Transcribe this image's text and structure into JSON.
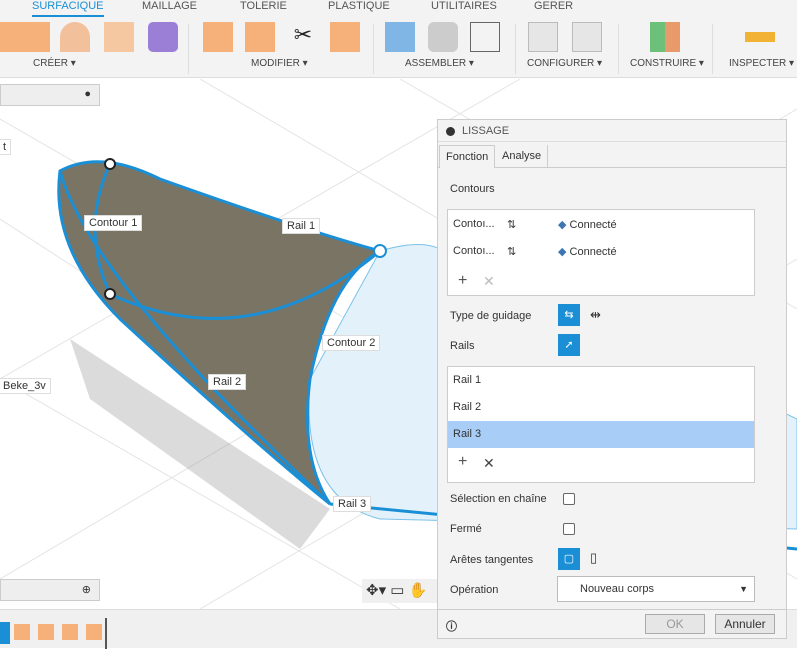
{
  "tabs": [
    "SURFACIQUE",
    "MAILLAGE",
    "TOLERIE",
    "PLASTIQUE",
    "UTILITAIRES",
    "GERER"
  ],
  "groups": [
    "CRÉER ▾",
    "MODIFIER ▾",
    "ASSEMBLER ▾",
    "CONFIGURER ▾",
    "CONSTRUIRE ▾",
    "INSPECTER ▾"
  ],
  "viewport": {
    "labels": {
      "contour1": "Contour 1",
      "contour2": "Contour 2",
      "rail1": "Rail 1",
      "rail2": "Rail 2",
      "rail3": "Rail 3",
      "body": "Beke_3v",
      "t": "t"
    }
  },
  "panel": {
    "title": "LISSAGE",
    "tabs": [
      "Fonction",
      "Analyse"
    ],
    "contours_label": "Contours",
    "contours": [
      {
        "name": "Contoı...",
        "status": "Connecté"
      },
      {
        "name": "Contoı...",
        "status": "Connecté"
      }
    ],
    "guidage_label": "Type de guidage",
    "rails_label": "Rails",
    "rails": [
      "Rail 1",
      "Rail 2",
      "Rail 3"
    ],
    "selected_rail": "Rail 3",
    "chain_label": "Sélection en chaîne",
    "closed_label": "Fermé",
    "tangent_label": "Arêtes tangentes",
    "operation_label": "Opération",
    "operation_value": "Nouveau corps",
    "ok": "OK",
    "cancel": "Annuler"
  },
  "colors": {
    "accent": "#1a8fd6",
    "selected": "#a8cdf7"
  }
}
